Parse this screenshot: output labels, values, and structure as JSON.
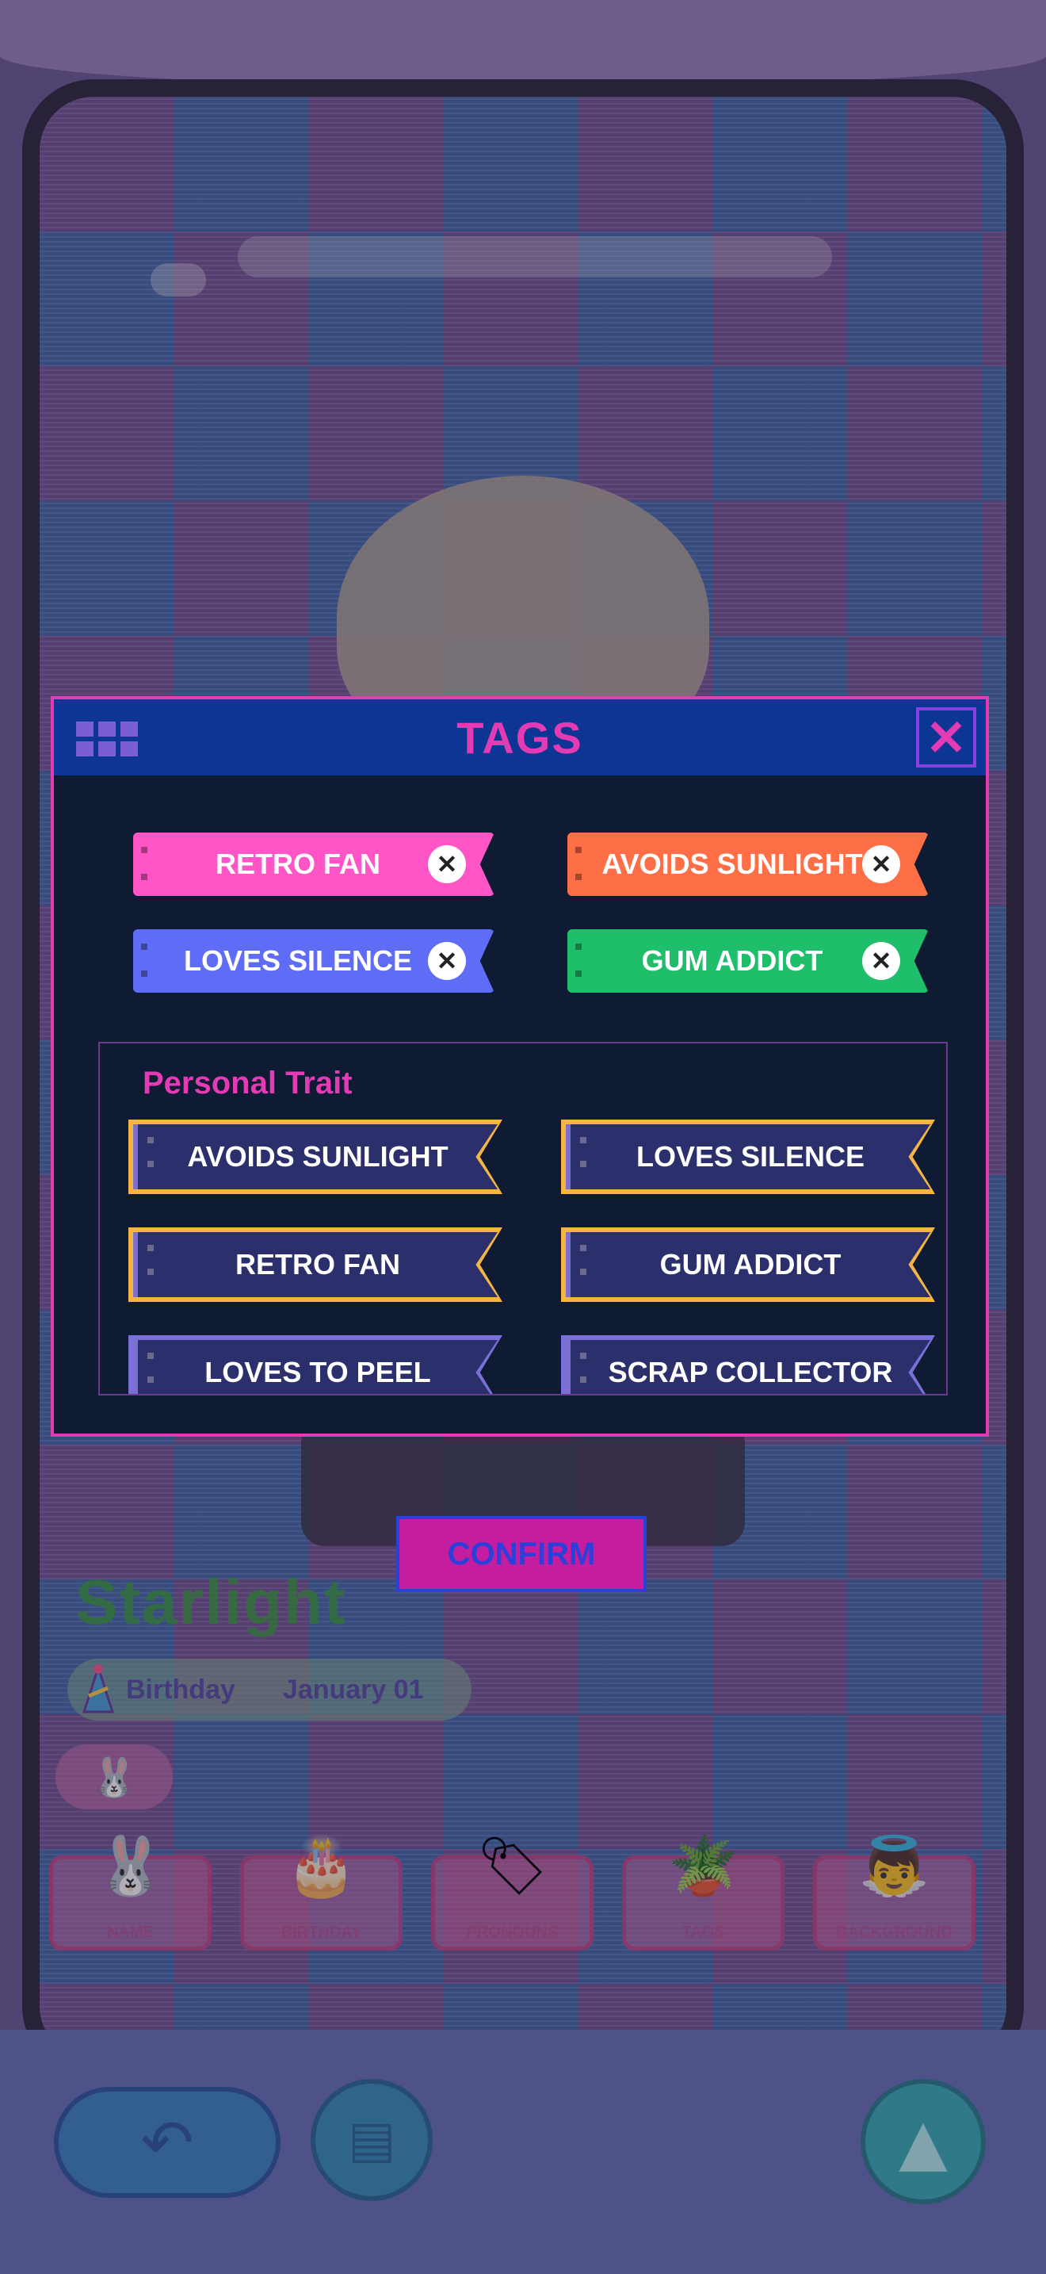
{
  "modal": {
    "title": "TAGS",
    "close": "✕",
    "selected_tags": [
      {
        "label": "RETRO FAN",
        "color": "#ff55c6"
      },
      {
        "label": "AVOIDS SUNLIGHT",
        "color": "#ff6f47"
      },
      {
        "label": "LOVES SILENCE",
        "color": "#5f6cf5"
      },
      {
        "label": "GUM ADDICT",
        "color": "#1fbe6a"
      }
    ],
    "section_title": "Personal Trait",
    "traits": [
      "AVOIDS SUNLIGHT",
      "LOVES SILENCE",
      "RETRO FAN",
      "GUM ADDICT",
      "LOVES TO PEEL",
      "SCRAP COLLECTOR"
    ]
  },
  "confirm_label": "CONFIRM",
  "profile": {
    "name": "Starlight",
    "birthday_label": "Birthday",
    "birthday_value": "January 01"
  },
  "menu": [
    {
      "icon": "rabbit-icon",
      "label": "NAME"
    },
    {
      "icon": "cake-icon",
      "label": "BIRTHDAY"
    },
    {
      "icon": "tag-icon",
      "label": "PRONOUNS"
    },
    {
      "icon": "plant-icon",
      "label": "TAGS"
    },
    {
      "icon": "angel-icon",
      "label": "BACKGROUND"
    }
  ],
  "nav": {
    "back_icon": "undo-icon",
    "notes_icon": "notes-icon",
    "up_icon": "up-arrow-icon"
  }
}
